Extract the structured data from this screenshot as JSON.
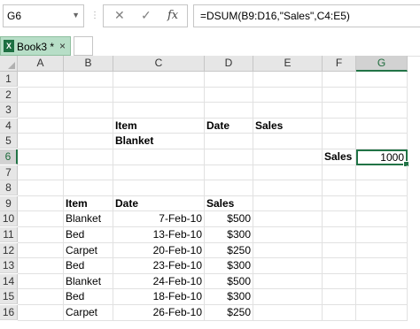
{
  "formula_bar": {
    "name_box": "G6",
    "cancel_symbol": "✕",
    "enter_symbol": "✓",
    "fx_label": "fx",
    "formula": "=DSUM(B9:D16,\"Sales\",C4:E5)"
  },
  "workbook": {
    "tab_label": "Book3 *",
    "close_symbol": "×"
  },
  "sheet": {
    "columns": [
      "A",
      "B",
      "C",
      "D",
      "E",
      "F",
      "G"
    ],
    "rows": [
      "1",
      "2",
      "3",
      "4",
      "5",
      "6",
      "7",
      "8",
      "9",
      "10",
      "11",
      "12",
      "13",
      "14",
      "15",
      "16"
    ],
    "active_cell": "G6",
    "cells": {
      "C4": "Item",
      "D4": "Date",
      "E4": "Sales",
      "C5": "Blanket",
      "F6": "Sales",
      "G6": "1000",
      "B9": "Item",
      "C9": "Date",
      "D9": "Sales",
      "B10": "Blanket",
      "C10": "7-Feb-10",
      "D10": "$500",
      "B11": "Bed",
      "C11": "13-Feb-10",
      "D11": "$300",
      "B12": "Carpet",
      "C12": "20-Feb-10",
      "D12": "$250",
      "B13": "Bed",
      "C13": "23-Feb-10",
      "D13": "$300",
      "B14": "Blanket",
      "C14": "24-Feb-10",
      "D14": "$500",
      "B15": "Bed",
      "C15": "18-Feb-10",
      "D15": "$300",
      "B16": "Carpet",
      "C16": "26-Feb-10",
      "D16": "$250"
    }
  }
}
